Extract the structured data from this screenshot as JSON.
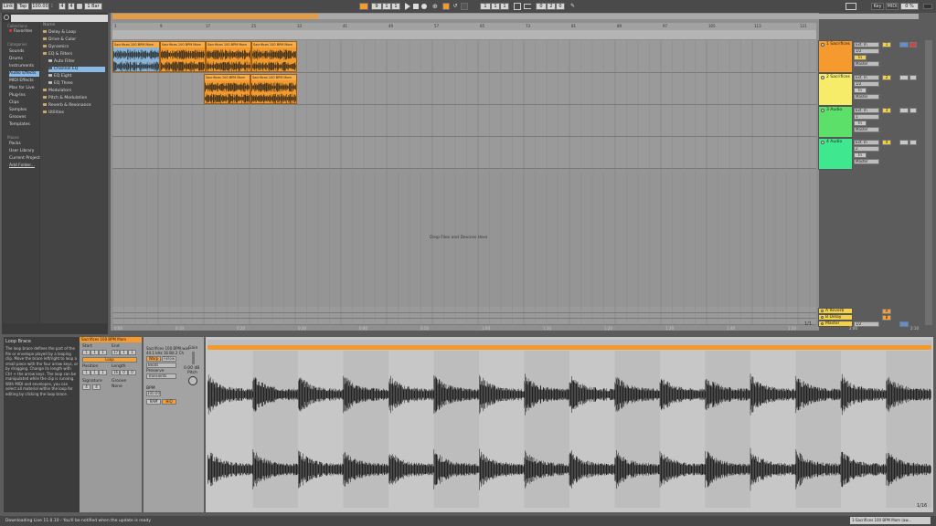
{
  "topbar": {
    "link": "Link",
    "tap": "Tap",
    "bpm": "100.00",
    "sig_num": "4",
    "sig_den": "4",
    "quant": "1 Bar",
    "pos1": "9",
    "pos2": "1",
    "pos3": "1",
    "loop_start": [
      "1",
      "1",
      "1"
    ],
    "loop_len": [
      "0",
      "2",
      "0"
    ],
    "key": "Key",
    "midi": "MIDI",
    "cpu": "0 %"
  },
  "browser": {
    "collections_label": "Collections",
    "favorites": "Favorites",
    "categories_label": "Categories",
    "categories": [
      "Sounds",
      "Drums",
      "Instruments",
      "Audio Effects",
      "MIDI Effects",
      "Max for Live",
      "Plug-Ins",
      "Clips",
      "Samples",
      "Grooves",
      "Templates"
    ],
    "places_label": "Places",
    "places": [
      "Packs",
      "User Library",
      "Current Project",
      "Add Folder..."
    ],
    "name_header": "Name",
    "tree": [
      "Delay & Loop",
      "Drive & Color",
      "Dynamics",
      "EQ & Filters",
      "Auto Filter",
      "Channel EQ",
      "EQ Eight",
      "EQ Three",
      "Modulators",
      "Pitch & Modulation",
      "Reverb & Resonance",
      "Utilities"
    ]
  },
  "ruler": {
    "bars": [
      "1",
      "9",
      "17",
      "25",
      "33",
      "41",
      "49",
      "57",
      "65",
      "73",
      "81",
      "89",
      "97",
      "105",
      "113",
      "121"
    ],
    "times": [
      "0:00",
      "0:10",
      "0:20",
      "0:30",
      "0:40",
      "0:50",
      "1:00",
      "1:10",
      "1:20",
      "1:30",
      "1:40",
      "1:50",
      "2:00",
      "2:10",
      "2:20"
    ]
  },
  "tracks": [
    {
      "name": "1 Sacrifices",
      "num": "1",
      "input": "Ext. In",
      "ch": "1/2",
      "monitor": "In",
      "out": "Master",
      "color": "#f59a2f"
    },
    {
      "name": "2 Sacrifices",
      "num": "2",
      "input": "Ext. In",
      "ch": "1/2",
      "monitor": "In",
      "out": "Master",
      "color": "#f6ec6a"
    },
    {
      "name": "3 Audio",
      "num": "3",
      "input": "Ext. In",
      "ch": "1",
      "monitor": "In",
      "out": "Master",
      "color": "#5de06a"
    },
    {
      "name": "4 Audio",
      "num": "4",
      "input": "Ext. In",
      "ch": "2",
      "monitor": "In",
      "out": "Master",
      "color": "#3fe88e"
    }
  ],
  "returns": [
    {
      "name": "A Reverb",
      "letter": "A"
    },
    {
      "name": "B Delay",
      "letter": "B"
    },
    {
      "name": "Master",
      "letter": ""
    }
  ],
  "master_ch": "1/2",
  "clip_name": "Sacrifices 100 BPM Mom",
  "drop_text": "Drop Files and Devices Here",
  "zoom_label": "1/1",
  "detail": {
    "info_title": "Loop Brace",
    "info_text": "The loop brace defines the part of the file or envelope played by a looping clip. Move the brace left/right to loop a small piece with the four arrow keys, or by dragging. Change its length with Ctrl + the arrow keys. The loop can be manipulated while the clip is running. With MIDI and envelopes, you can select all material within the loop for editing by clicking the loop brace.",
    "clip_title": "Sacrifices 100 BPM Mom",
    "start": "Start",
    "end": "End",
    "loop": "Loop",
    "position": "Position",
    "length": "Length",
    "signature": "Signature",
    "groove": "Groove",
    "none": "None",
    "start_vals": [
      "1",
      "1",
      "1"
    ],
    "end_vals": [
      "17",
      "1",
      "1"
    ],
    "pos_vals": [
      "1",
      "1",
      "1"
    ],
    "len_vals": [
      "16",
      "0",
      "0"
    ],
    "sig": [
      "4",
      "4"
    ],
    "sample_name": "Sacrifices 100 BPM.wav",
    "sample_info": "44.1 kHz 16 Bit 2 Ch",
    "warp": "Warp",
    "follow": "Follow",
    "beats": "Beats",
    "preserve": "Preserve",
    "transients": "Transients",
    "seg_bpm": "BPM",
    "bpm_val": "100.00",
    "ram": "RAM",
    "hiq": "HiQ",
    "gain": "Gain",
    "gain_val": "0.00 dB",
    "pitch": "Pitch",
    "zoom": "1/16"
  },
  "status": "Downloading Live 11.0.10 - You'll be notified when the update is ready",
  "status_clip": "1-Sacrifices 100 BPM Mom (aw..."
}
